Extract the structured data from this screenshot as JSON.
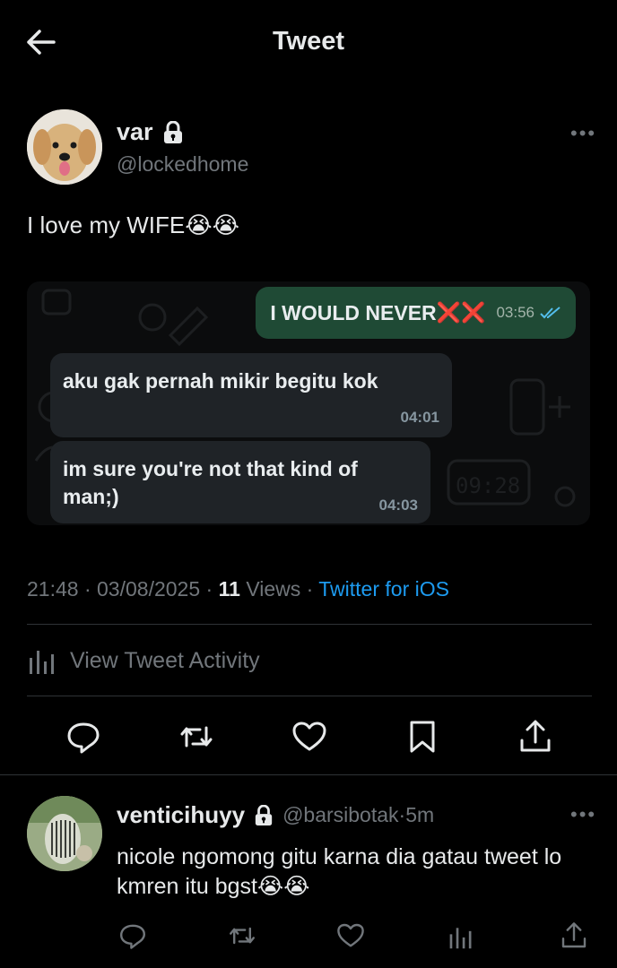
{
  "header": {
    "title": "Tweet"
  },
  "tweet": {
    "display_name": "var",
    "handle": "@lockedhome",
    "text": "I love my WIFE😭😭",
    "time": "21:48",
    "date": "03/08/2025",
    "views_count": "11",
    "views_label": "Views",
    "source": "Twitter for iOS",
    "activity_label": "View Tweet Activity"
  },
  "chat": {
    "outgoing": {
      "text": "I WOULD NEVER",
      "marks": "❌❌",
      "time": "03:56"
    },
    "incoming": [
      {
        "text": "aku gak pernah mikir begitu kok",
        "time": "04:01"
      },
      {
        "text": "im sure you're not that kind of man;)",
        "time": "04:03"
      }
    ],
    "bg_doodle": "09:28"
  },
  "reply": {
    "display_name": "venticihuyy",
    "handle": "@barsibotak",
    "age": "5m",
    "text": "nicole ngomong gitu karna dia gatau tweet lo kmren itu bgst😭😭"
  },
  "colors": {
    "bg": "#000000",
    "accent": "#1d9bf0",
    "muted": "#71767b",
    "outgoing_bubble": "#1f4a35",
    "incoming_bubble": "#1f2327"
  },
  "icons": [
    "back-arrow-icon",
    "lock-icon",
    "more-icon",
    "reply-icon",
    "retweet-icon",
    "like-icon",
    "bookmark-icon",
    "share-icon",
    "analytics-icon",
    "double-check-icon"
  ]
}
